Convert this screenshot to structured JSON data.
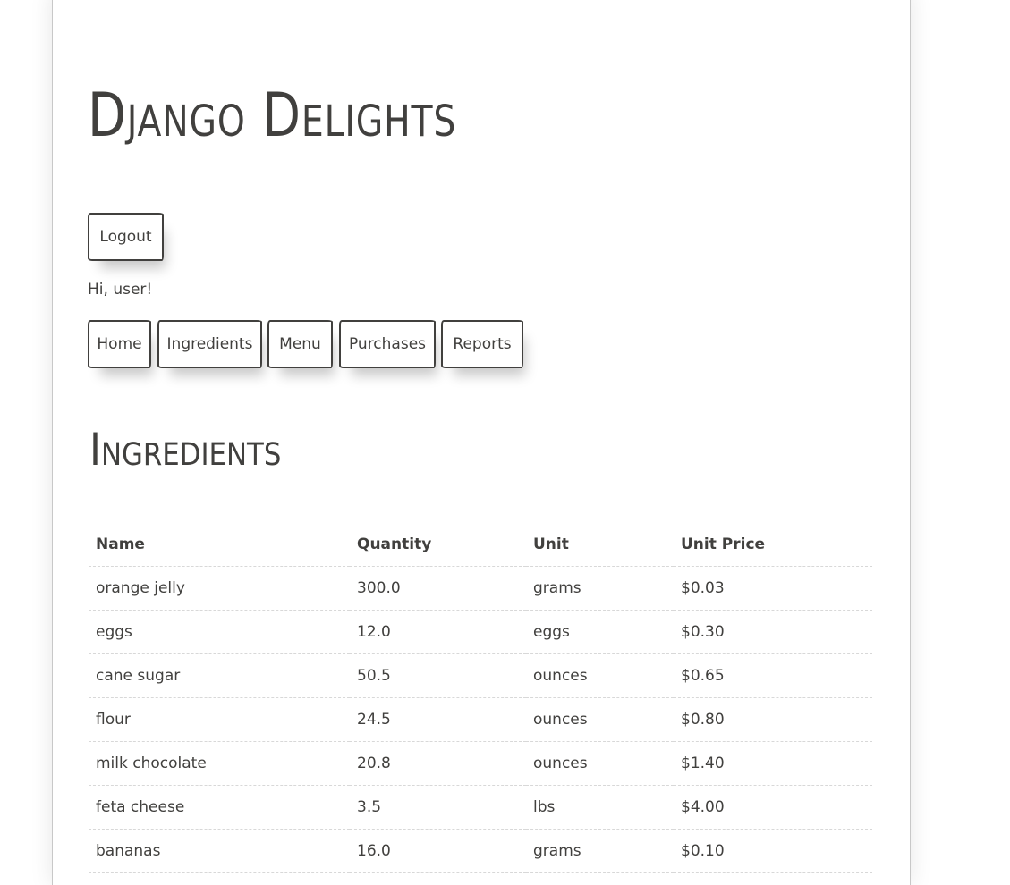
{
  "site": {
    "title": "Django Delights"
  },
  "auth": {
    "logout_label": "Logout",
    "greeting": "Hi, user!"
  },
  "nav": {
    "items": [
      {
        "label": "Home"
      },
      {
        "label": "Ingredients"
      },
      {
        "label": "Menu"
      },
      {
        "label": "Purchases"
      },
      {
        "label": "Reports"
      }
    ]
  },
  "page": {
    "heading": "Ingredients"
  },
  "table": {
    "columns": [
      "Name",
      "Quantity",
      "Unit",
      "Unit Price"
    ],
    "rows": [
      [
        "orange jelly",
        "300.0",
        "grams",
        "$0.03"
      ],
      [
        "eggs",
        "12.0",
        "eggs",
        "$0.30"
      ],
      [
        "cane sugar",
        "50.5",
        "ounces",
        "$0.65"
      ],
      [
        "flour",
        "24.5",
        "ounces",
        "$0.80"
      ],
      [
        "milk chocolate",
        "20.8",
        "ounces",
        "$1.40"
      ],
      [
        "feta cheese",
        "3.5",
        "lbs",
        "$4.00"
      ],
      [
        "bananas",
        "16.0",
        "grams",
        "$0.10"
      ]
    ]
  }
}
